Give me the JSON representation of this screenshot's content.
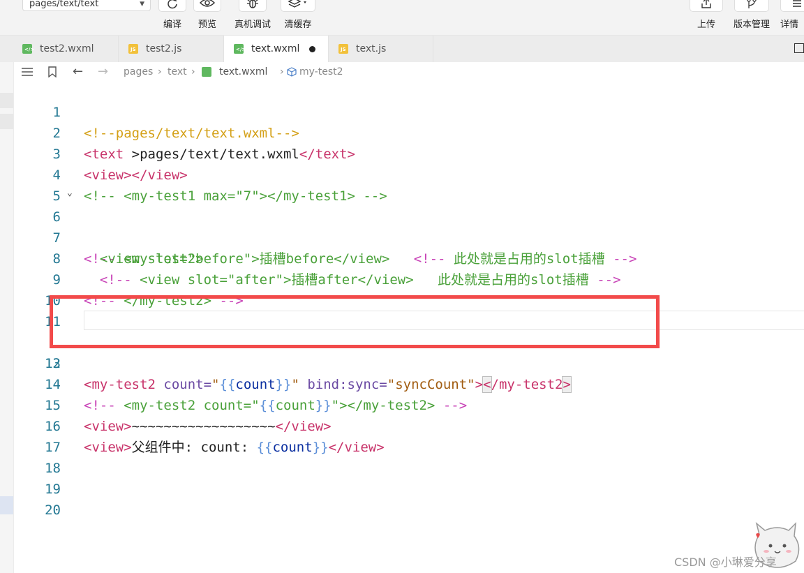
{
  "toolbar": {
    "path": "pages/text/text",
    "left_tools": [
      {
        "label": "编译",
        "icon": "refresh-icon"
      },
      {
        "label": "预览",
        "icon": "eye-icon"
      },
      {
        "label": "真机调试",
        "icon": "bug-icon"
      },
      {
        "label": "清缓存",
        "icon": "layers-icon"
      }
    ],
    "right_tools": [
      {
        "label": "上传",
        "icon": "upload-icon"
      },
      {
        "label": "版本管理",
        "icon": "branch-icon"
      },
      {
        "label": "详情",
        "icon": "menu-icon"
      }
    ]
  },
  "tabs": [
    {
      "name": "test2.wxml",
      "type": "wxml"
    },
    {
      "name": "test2.js",
      "type": "js"
    },
    {
      "name": "text.wxml",
      "type": "wxml",
      "active": true,
      "modified": true
    },
    {
      "name": "text.js",
      "type": "js"
    }
  ],
  "breadcrumb": [
    "pages",
    "text",
    "text.wxml",
    "my-test2"
  ],
  "line_numbers": [
    "1",
    "2",
    "3",
    "4",
    "5",
    "6",
    "7",
    "8",
    "9",
    "10",
    "11",
    "12",
    "13",
    "14",
    "15",
    "16",
    "17",
    "18",
    "19",
    "20"
  ],
  "code": {
    "l1": "<!--pages/text/text.wxml-->",
    "l2": [
      "<text",
      " >pages/text/text.wxml",
      "</text>"
    ],
    "l3": [
      "<view></view>"
    ],
    "l4": "<!-- <my-test1 max=\"7\"></my-test1> -->",
    "l6": [
      "<!-- ",
      "<my-test2>"
    ],
    "l7": [
      "  <view slot=\"before\">插槽before</view>   ",
      "<!-- ",
      "此处就是占用的slot插槽",
      " -->"
    ],
    "l8": [
      "  <!-- ",
      "<view slot=\"after\">插槽after</view>   此处就是占用的slot插槽",
      " -->"
    ],
    "l9": [
      "<!-- ",
      "</my-test2>",
      " -->"
    ],
    "l12": {
      "open": "<my-test2",
      "attr1": " count=",
      "q": "\"",
      "b1": "{{",
      "v1": "count",
      "b2": "}}",
      "attr2": " bind:sync=",
      "s2": "\"syncCount\"",
      "gt": ">",
      "lt": "<",
      "close": "/my-test2",
      "gt2": ">"
    },
    "l14": {
      "cm1": "<!-- ",
      "tag": "<my-test2 count=\"",
      "b1": "{{",
      "v": "count",
      "b2": "}}",
      "tag2": "\"></my-test2>",
      "cm2": " -->"
    },
    "l15": {
      "open": "<view>",
      "txt": "~~~~~~~~~~~~~~~~~~",
      "close": "</view>"
    },
    "l16": {
      "open": "<view>",
      "txt": "父组件中: count: ",
      "b1": "{{",
      "v": "count",
      "b2": "}}",
      "close": "</view>"
    }
  },
  "watermark": "CSDN @小琳爱分享"
}
